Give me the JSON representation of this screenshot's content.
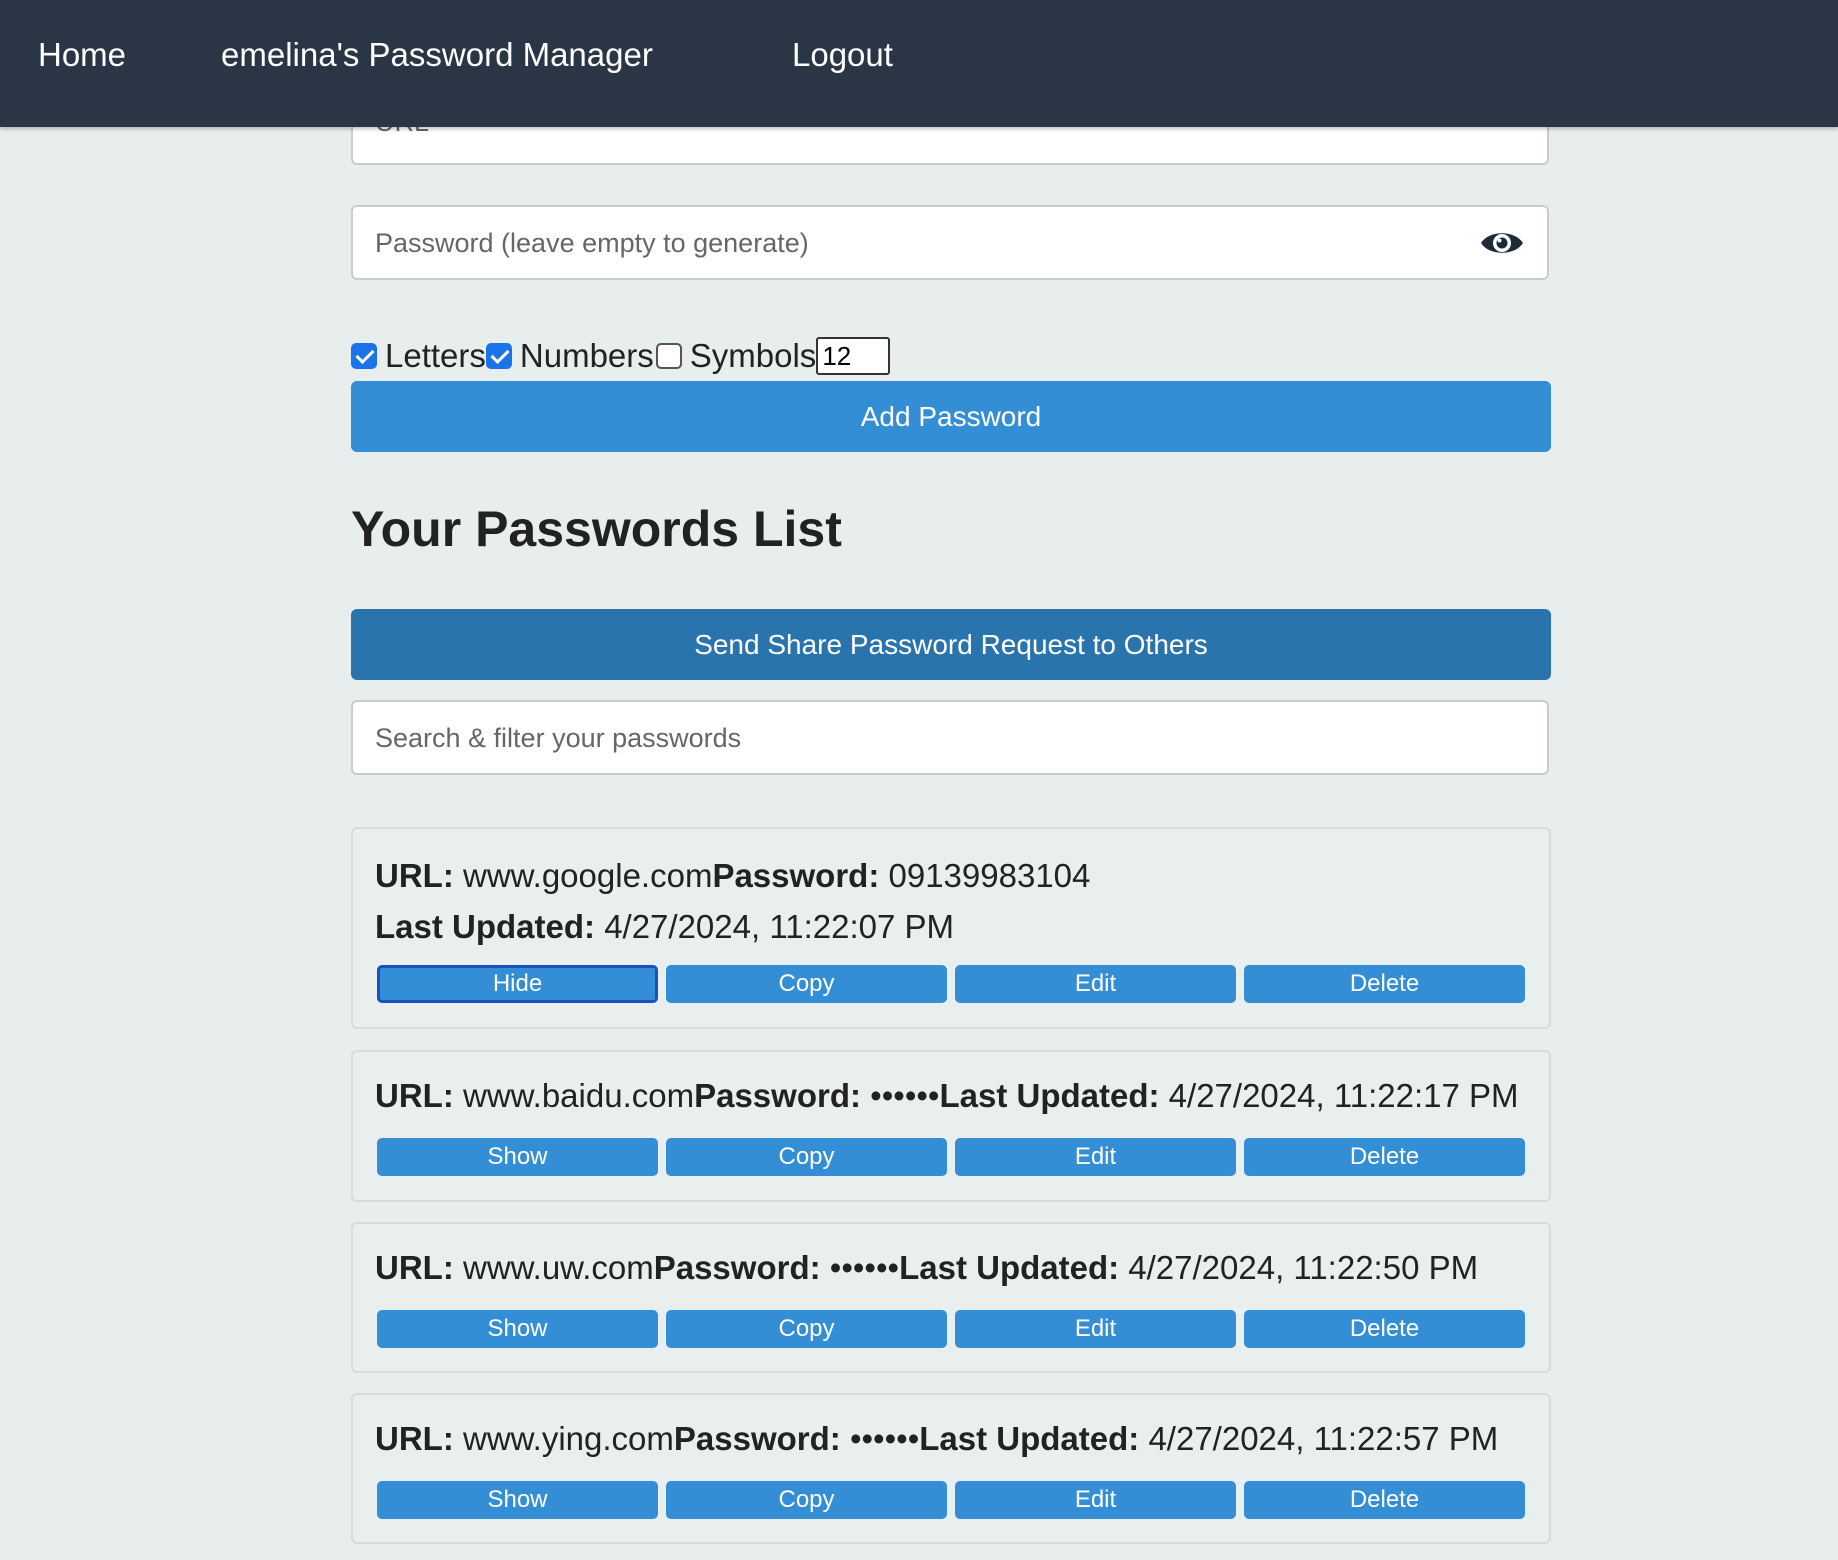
{
  "nav": {
    "home": "Home",
    "title": "emelina's Password Manager",
    "logout": "Logout"
  },
  "form": {
    "url_placeholder": "URL",
    "password_placeholder": "Password (leave empty to generate)",
    "eye_icon": "eye-icon",
    "options": {
      "letters_label": "Letters",
      "letters_checked": true,
      "numbers_label": "Numbers",
      "numbers_checked": true,
      "symbols_label": "Symbols",
      "symbols_checked": false,
      "length_value": "12"
    },
    "add_button": "Add Password"
  },
  "list": {
    "heading": "Your Passwords List",
    "share_button": "Send Share Password Request to Others",
    "search_placeholder": "Search & filter your passwords",
    "url_label": "URL:",
    "password_label": "Password:",
    "updated_label": "Last Updated:",
    "entries": [
      {
        "url": "www.google.com",
        "password": "09139983104",
        "updated": "4/27/2024, 11:22:07 PM",
        "toggle": "Hide",
        "copy": "Copy",
        "edit": "Edit",
        "delete": "Delete"
      },
      {
        "url": "www.baidu.com",
        "password": "••••••",
        "updated": "4/27/2024, 11:22:17 PM",
        "toggle": "Show",
        "copy": "Copy",
        "edit": "Edit",
        "delete": "Delete"
      },
      {
        "url": "www.uw.com",
        "password": "••••••",
        "updated": "4/27/2024, 11:22:50 PM",
        "toggle": "Show",
        "copy": "Copy",
        "edit": "Edit",
        "delete": "Delete"
      },
      {
        "url": "www.ying.com",
        "password": "••••••",
        "updated": "4/27/2024, 11:22:57 PM",
        "toggle": "Show",
        "copy": "Copy",
        "edit": "Edit",
        "delete": "Delete"
      }
    ]
  },
  "colors": {
    "navbar": "#2a3646",
    "primary_button": "#348ed6",
    "share_button": "#2a74ae",
    "background": "#e8eeee"
  }
}
